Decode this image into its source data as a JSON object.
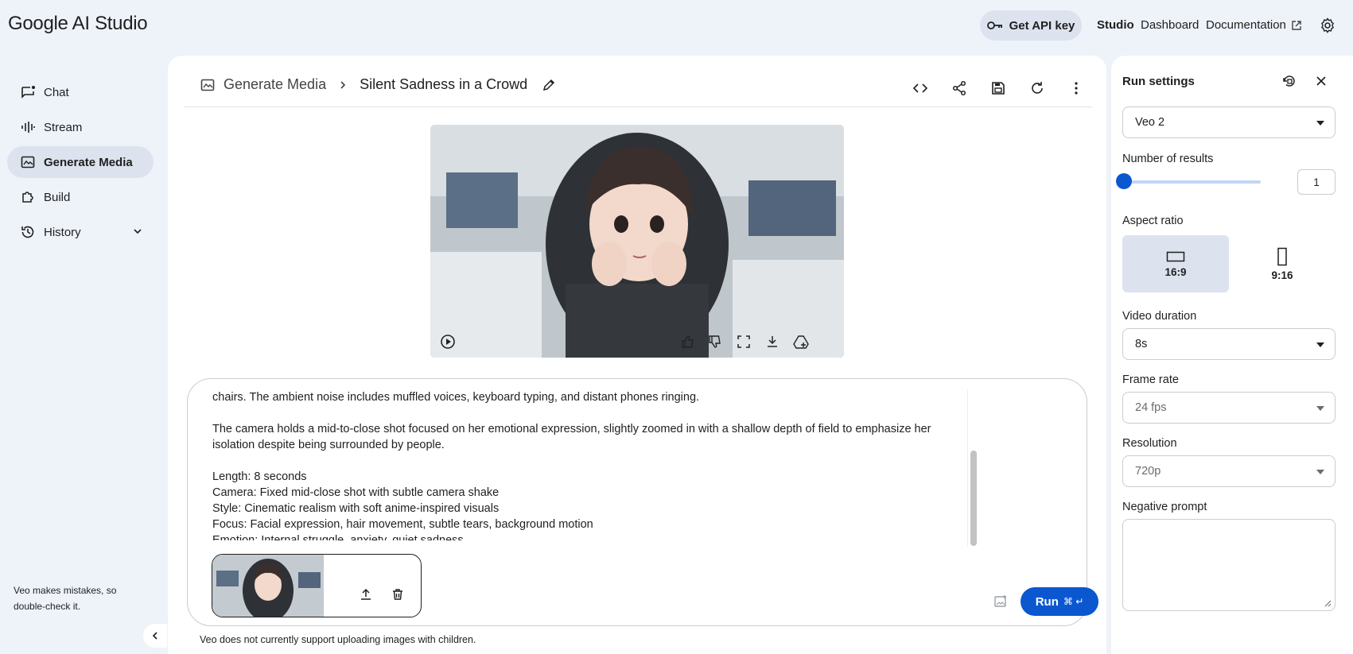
{
  "app": {
    "logo": "Google AI Studio"
  },
  "topbar": {
    "api_key_label": "Get API key",
    "studio_label": "Studio",
    "dashboard_label": "Dashboard",
    "documentation_label": "Documentation"
  },
  "sidebar": {
    "items": [
      {
        "label": "Chat",
        "icon": "chat-icon"
      },
      {
        "label": "Stream",
        "icon": "waveform-icon"
      },
      {
        "label": "Generate Media",
        "icon": "media-icon",
        "active": true
      },
      {
        "label": "Build",
        "icon": "puzzle-icon"
      },
      {
        "label": "History",
        "icon": "history-icon"
      }
    ],
    "note": "Veo makes mistakes, so double-check it."
  },
  "main": {
    "breadcrumb_root": "Generate Media",
    "breadcrumb_title": "Silent Sadness in a Crowd",
    "prompt_lines": [
      "chairs. The ambient noise includes muffled voices, keyboard typing, and distant phones ringing.",
      "",
      "The camera holds a mid-to-close shot focused on her emotional expression, slightly zoomed in with a shallow depth of field to emphasize her isolation despite being surrounded by people.",
      "",
      "Length: 8 seconds",
      "Camera: Fixed mid-close shot with subtle camera shake",
      "Style: Cinematic realism with soft anime-inspired visuals",
      "Focus: Facial expression, hair movement, subtle tears, background motion",
      "Emotion: Internal struggle, anxiety, quiet sadness"
    ],
    "run_label": "Run",
    "run_shortcut": "⌘ ↵",
    "footer_note": "Veo does not currently support uploading images with children."
  },
  "run_settings": {
    "title": "Run settings",
    "model": "Veo 2",
    "num_results_label": "Number of results",
    "num_results": "1",
    "num_results_fraction": 0,
    "aspect_label": "Aspect ratio",
    "aspect_options": [
      "16:9",
      "9:16"
    ],
    "duration_label": "Video duration",
    "duration": "8s",
    "frame_rate_label": "Frame rate",
    "frame_rate": "24 fps",
    "resolution_label": "Resolution",
    "resolution": "720p",
    "negative_prompt_label": "Negative prompt"
  },
  "colors": {
    "accent": "#0b57d0",
    "nav_active": "#dce3ee",
    "page_bg": "#eef2f9"
  }
}
